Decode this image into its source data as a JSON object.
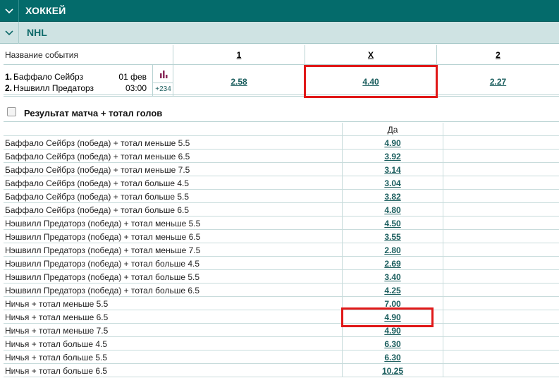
{
  "sport": {
    "title": "ХОККЕЙ"
  },
  "league": {
    "title": "NHL"
  },
  "events_header": {
    "name_label": "Название события",
    "col_1": "1",
    "col_x": "X",
    "col_2": "2"
  },
  "event": {
    "team1_num": "1.",
    "team1": "Баффало Сейбрз",
    "team2_num": "2.",
    "team2": "Нэшвилл Предаторз",
    "date": "01 фев",
    "time": "03:00",
    "more": "+234",
    "odd_1": "2.58",
    "odd_x": "4.40",
    "odd_2": "2.27"
  },
  "market": {
    "title": "Результат матча + тотал голов",
    "col_yes": "Да",
    "rows": [
      {
        "label": "Баффало Сейбрз (победа) + тотал меньше 5.5",
        "value": "4.90"
      },
      {
        "label": "Баффало Сейбрз (победа) + тотал меньше 6.5",
        "value": "3.92"
      },
      {
        "label": "Баффало Сейбрз (победа) + тотал меньше 7.5",
        "value": "3.14"
      },
      {
        "label": "Баффало Сейбрз (победа) + тотал больше 4.5",
        "value": "3.04"
      },
      {
        "label": "Баффало Сейбрз (победа) + тотал больше 5.5",
        "value": "3.82"
      },
      {
        "label": "Баффало Сейбрз (победа) + тотал больше 6.5",
        "value": "4.80"
      },
      {
        "label": "Нэшвилл Предаторз (победа) + тотал меньше 5.5",
        "value": "4.50"
      },
      {
        "label": "Нэшвилл Предаторз (победа) + тотал меньше 6.5",
        "value": "3.55"
      },
      {
        "label": "Нэшвилл Предаторз (победа) + тотал меньше 7.5",
        "value": "2.80"
      },
      {
        "label": "Нэшвилл Предаторз (победа) + тотал больше 4.5",
        "value": "2.69"
      },
      {
        "label": "Нэшвилл Предаторз (победа) + тотал больше 5.5",
        "value": "3.40"
      },
      {
        "label": "Нэшвилл Предаторз (победа) + тотал больше 6.5",
        "value": "4.25"
      },
      {
        "label": "Ничья + тотал меньше 5.5",
        "value": "7.00"
      },
      {
        "label": "Ничья + тотал меньше 6.5",
        "value": "4.90"
      },
      {
        "label": "Ничья + тотал меньше 7.5",
        "value": "4.90"
      },
      {
        "label": "Ничья + тотал больше 4.5",
        "value": "6.30"
      },
      {
        "label": "Ничья + тотал больше 5.5",
        "value": "6.30"
      },
      {
        "label": "Ничья + тотал больше 6.5",
        "value": "10.25"
      }
    ]
  },
  "colors": {
    "sport_bar": "#046b6b",
    "league_bar": "#cfe3e3",
    "link": "#1b5e5e",
    "highlight": "#e01818"
  }
}
